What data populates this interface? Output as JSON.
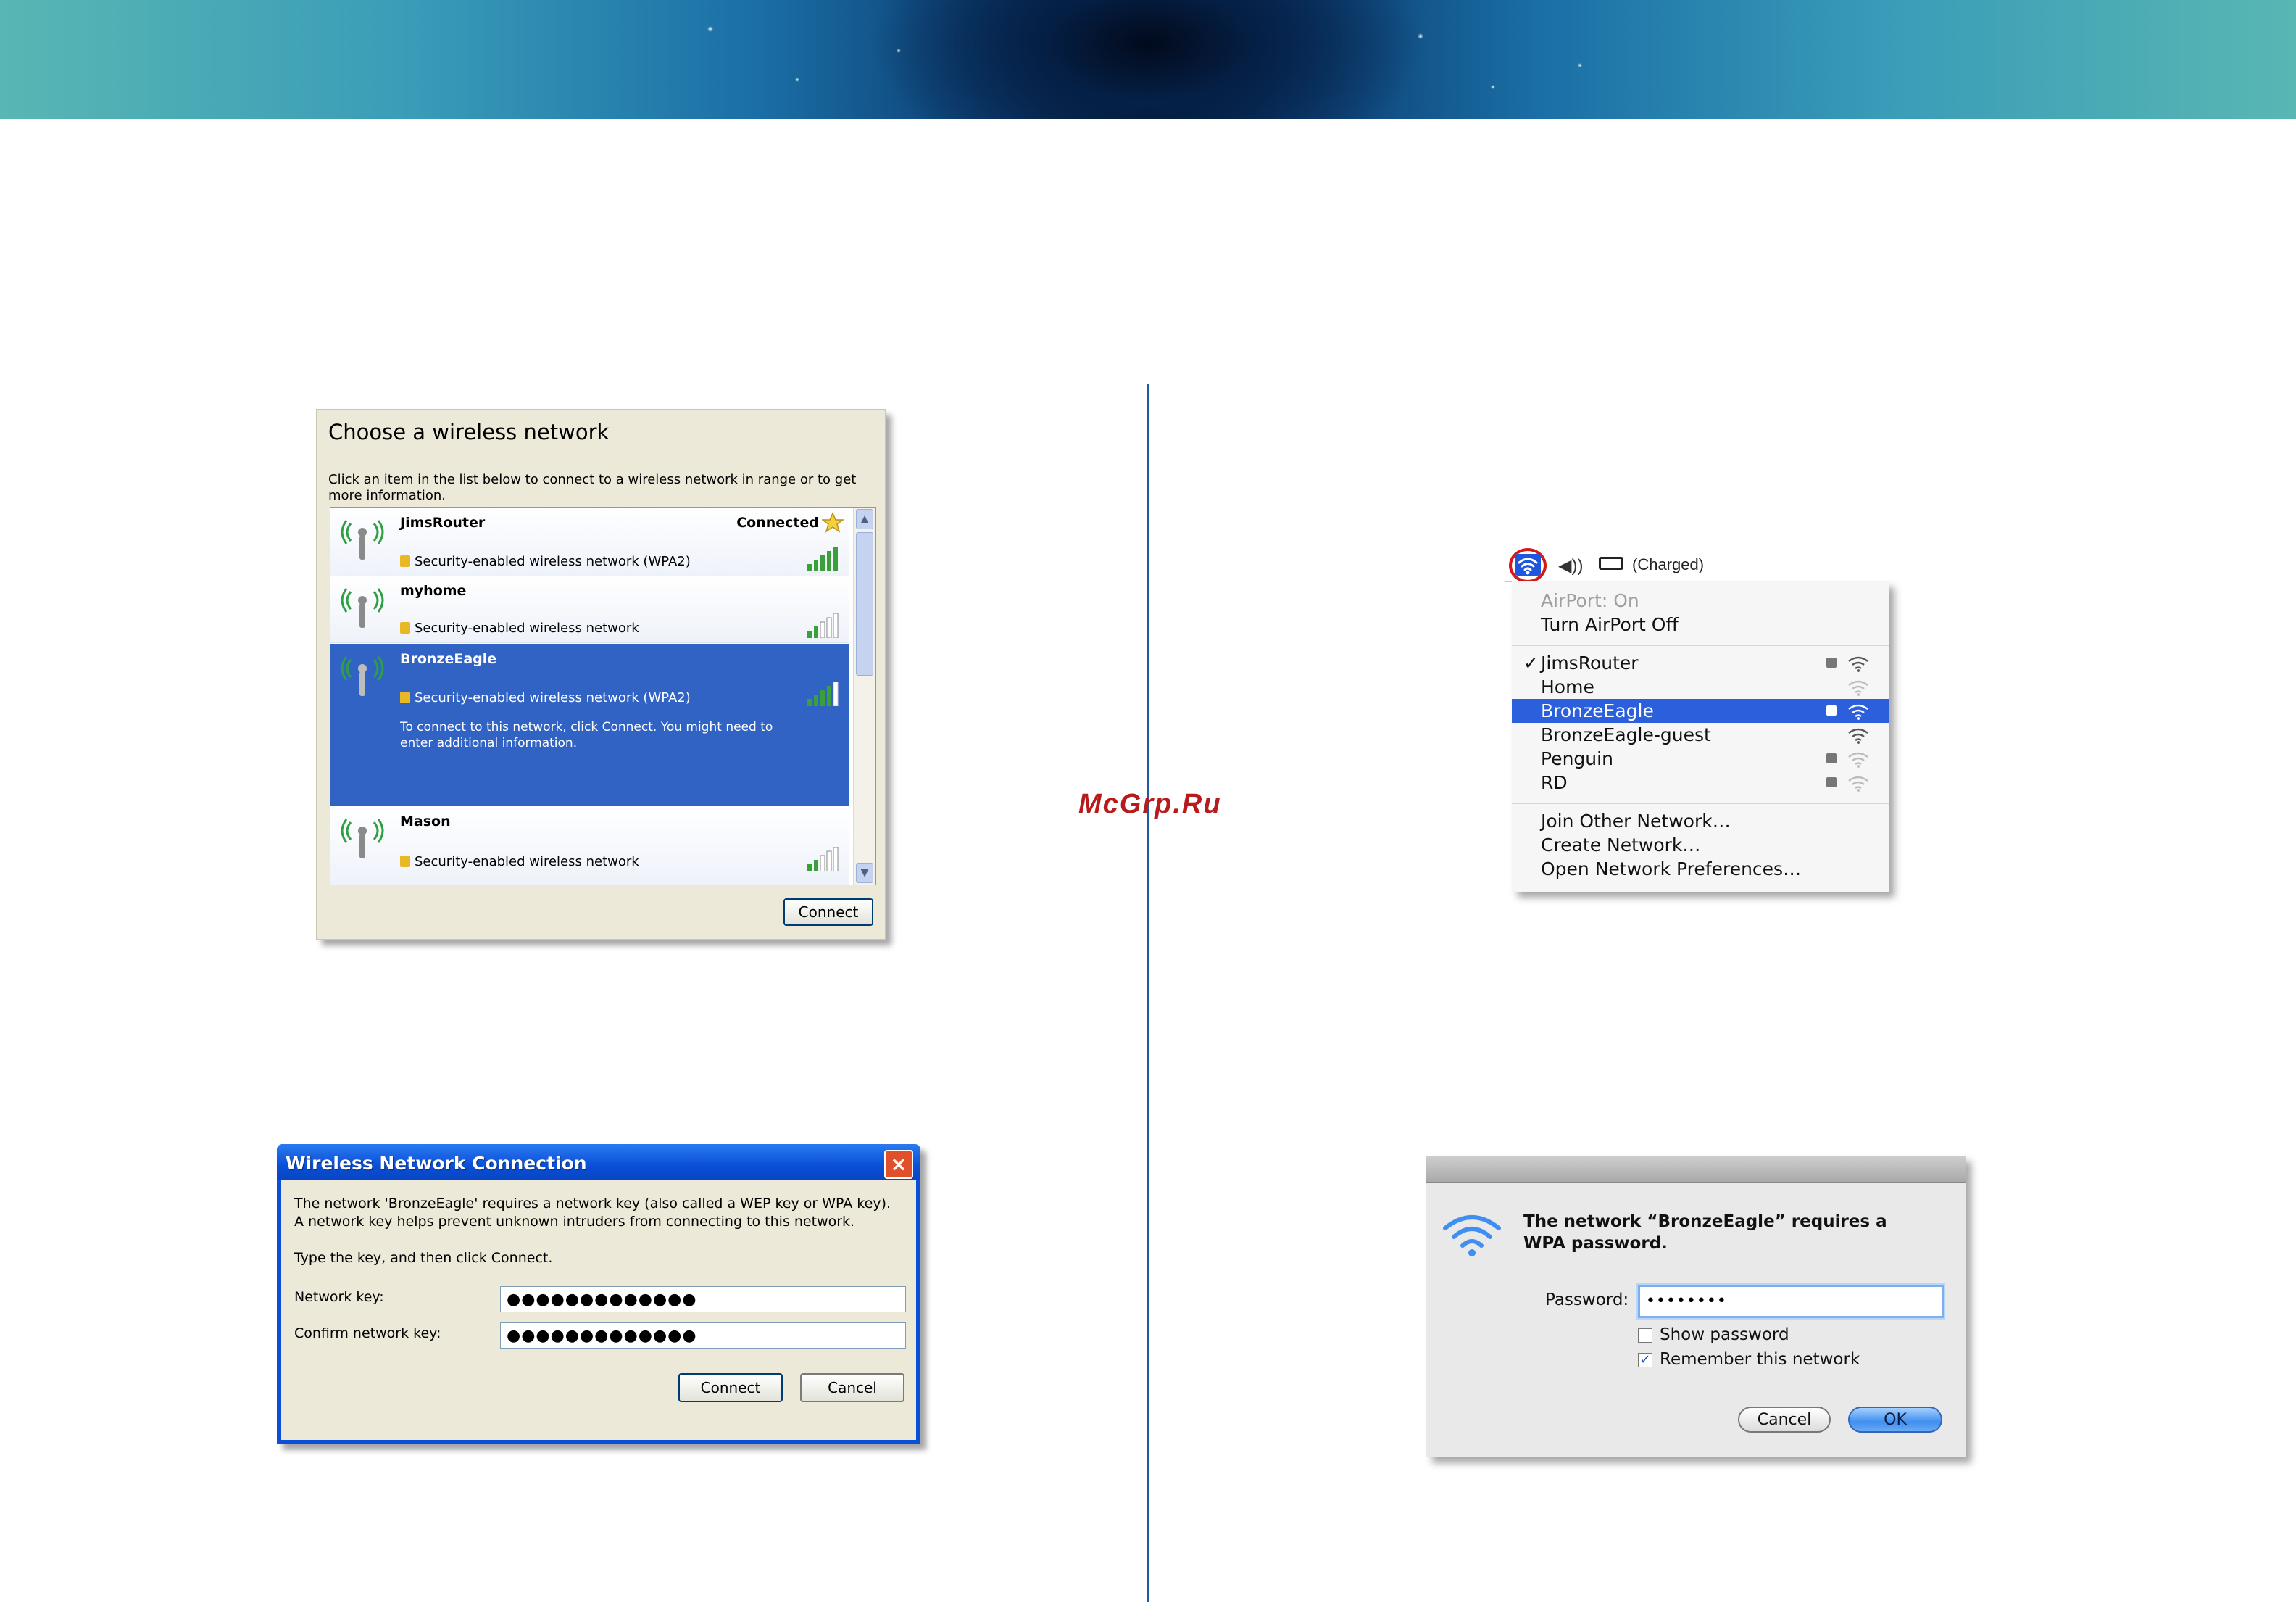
{
  "watermark": "McGrp.Ru",
  "xp_choose": {
    "title": "Choose a wireless network",
    "description": "Click an item in the list below to connect to a wireless network in range or to get more information.",
    "networks": [
      {
        "name": "JimsRouter",
        "status": "Connected",
        "security": "Security-enabled wireless network (WPA2)"
      },
      {
        "name": "myhome",
        "status": "",
        "security": "Security-enabled wireless network"
      },
      {
        "name": "BronzeEagle",
        "status": "",
        "security": "Security-enabled wireless network (WPA2)",
        "hint": "To connect to this network, click Connect. You might need to enter additional information."
      },
      {
        "name": "Mason",
        "status": "",
        "security": "Security-enabled wireless network"
      }
    ],
    "connect_label": "Connect"
  },
  "xp_connection": {
    "title": "Wireless Network Connection",
    "message": "The network 'BronzeEagle' requires a network key (also called a WEP key or WPA key). A network key helps prevent unknown intruders from connecting to this network.",
    "instruction": "Type the key, and then click Connect.",
    "network_key_label": "Network key:",
    "network_key_value": "●●●●●●●●●●●●●",
    "confirm_key_label": "Confirm network key:",
    "confirm_key_value": "●●●●●●●●●●●●●",
    "connect_label": "Connect",
    "cancel_label": "Cancel"
  },
  "mac_menu": {
    "battery_status": "(Charged)",
    "airport_status": "AirPort: On",
    "turn_off": "Turn AirPort Off",
    "networks": [
      {
        "name": "JimsRouter",
        "checked": "✓",
        "locked": true
      },
      {
        "name": "Home",
        "checked": "",
        "locked": false
      },
      {
        "name": "BronzeEagle",
        "checked": "",
        "locked": true
      },
      {
        "name": "BronzeEagle-guest",
        "checked": "",
        "locked": false
      },
      {
        "name": "Penguin",
        "checked": "",
        "locked": true
      },
      {
        "name": "RD",
        "checked": "",
        "locked": true
      }
    ],
    "join_other": "Join Other Network…",
    "create_network": "Create Network…",
    "open_prefs": "Open Network Preferences…"
  },
  "mac_dialog": {
    "message": "The network “BronzeEagle” requires a WPA password.",
    "password_label": "Password:",
    "password_value": "••••••••",
    "show_password_label": "Show password",
    "show_password_checked": false,
    "remember_label": "Remember this network",
    "remember_checked": true,
    "cancel_label": "Cancel",
    "ok_label": "OK"
  }
}
